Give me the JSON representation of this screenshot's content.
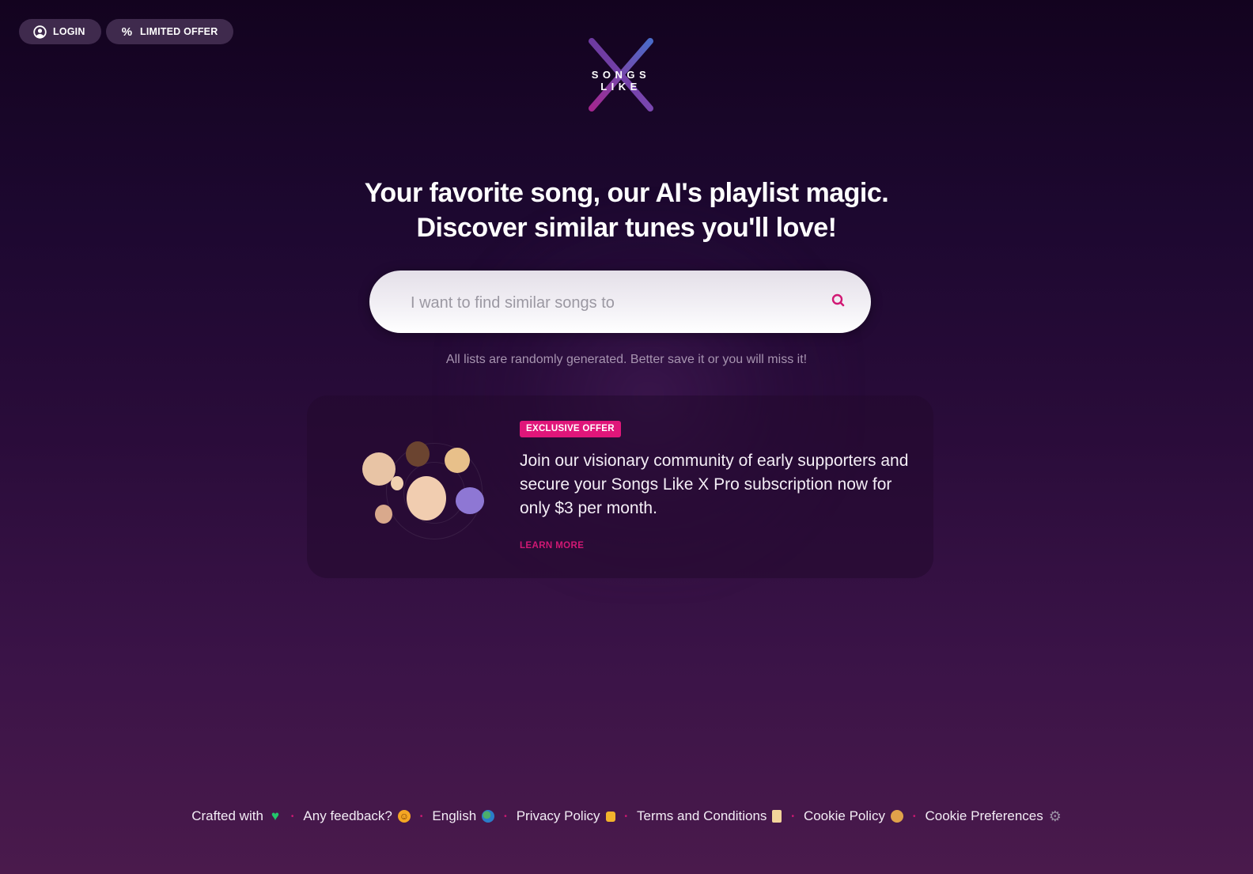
{
  "topbar": {
    "login_label": "LOGIN",
    "login_icon": "user-circle-icon",
    "offer_label": "LIMITED OFFER",
    "offer_icon": "percent-icon",
    "offer_glyph": "%"
  },
  "logo": {
    "word": "SONGS LIKE",
    "mark": "X"
  },
  "hero": {
    "line1": "Your favorite song, our AI's playlist magic.",
    "line2": "Discover similar tunes you'll love!"
  },
  "search": {
    "placeholder": "I want to find similar songs to",
    "value": "",
    "icon": "search-icon"
  },
  "note": "All lists are randomly generated. Better save it or you will miss it!",
  "offer_card": {
    "badge": "EXCLUSIVE OFFER",
    "text": "Join our visionary community of early supporters and secure your Songs Like X Pro subscription now for only $3 per month.",
    "learn_more": "LEARN MORE",
    "image": "memoji-community-cluster"
  },
  "colors": {
    "accent": "#e0167a",
    "link": "#d11874",
    "button_bg": "#3f2a4d"
  },
  "footer": {
    "items": [
      {
        "label": "Crafted with",
        "icon": "green-heart-icon",
        "glyph": "♥"
      },
      {
        "label": "Any feedback?",
        "icon": "hugging-face-icon",
        "glyph": "☺"
      },
      {
        "label": "English",
        "icon": "globe-icon",
        "glyph": "●"
      },
      {
        "label": "Privacy Policy",
        "icon": "lock-icon",
        "glyph": "🔒"
      },
      {
        "label": "Terms and Conditions",
        "icon": "scroll-icon",
        "glyph": "▯"
      },
      {
        "label": "Cookie Policy",
        "icon": "cookie-icon",
        "glyph": "●"
      },
      {
        "label": "Cookie Preferences",
        "icon": "gear-icon",
        "glyph": "⚙"
      }
    ],
    "separator": "•"
  }
}
